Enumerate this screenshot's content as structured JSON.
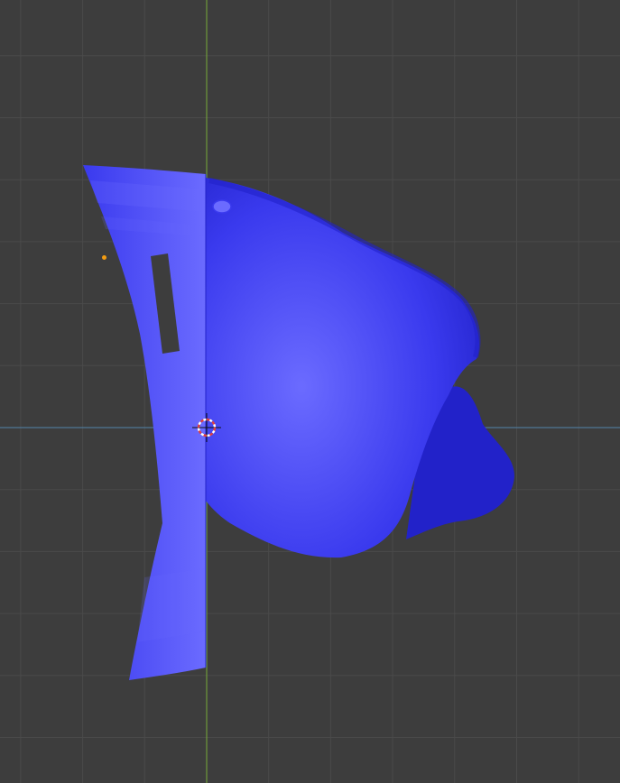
{
  "viewport": {
    "background_color": "#3d3d3d",
    "grid_minor_color": "#4a4a4a",
    "grid_major_color": "#555555",
    "axis_y_color": "#6f9a3a",
    "axis_x_color": "#4f7796"
  },
  "mesh": {
    "color": "#3a3aee",
    "highlight_color": "#6b6bff",
    "shadow_color": "#2222c9",
    "slot_color": "#3d3d3d"
  },
  "origin": {
    "color": "#f39c12"
  },
  "cursor_3d": {
    "icon": "3d-cursor-icon",
    "ring_colors": [
      "#e04040",
      "#ffffff"
    ],
    "crosshair_color": "#111111"
  }
}
